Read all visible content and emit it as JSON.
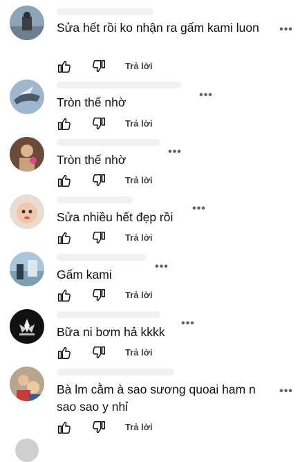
{
  "comments": [
    {
      "text": "Sửa hết rồi ko nhận ra gấm kami luon",
      "reply": "Trả lời",
      "top": 0
    },
    {
      "text": "Tròn thế nhờ",
      "reply": "Trả lời"
    },
    {
      "text": "Tròn thế nhờ",
      "reply": "Trả lời"
    },
    {
      "text": "Sửa nhiều hết đẹp rồi",
      "reply": "Trả lời"
    },
    {
      "text": "Gấm kami",
      "reply": "Trả lời"
    },
    {
      "text": "Bữa ni bơm hả kkkk",
      "reply": "Trả lời"
    },
    {
      "text": "Bà lm cằm à sao sương quoai ham n sao sao y nhỉ",
      "reply": "Trả lời"
    }
  ],
  "icons": {
    "like": "thumbs-up-icon",
    "dislike": "thumbs-down-icon",
    "more": "more-options-icon"
  },
  "colors": {
    "text": "#0f0f0f",
    "secondary": "#606060"
  }
}
